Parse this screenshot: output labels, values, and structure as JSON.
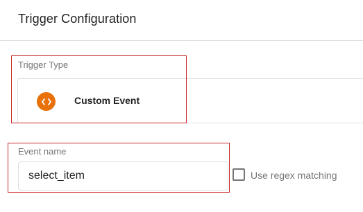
{
  "header": {
    "title": "Trigger Configuration"
  },
  "trigger_type": {
    "label": "Trigger Type",
    "selected": {
      "name": "Custom Event",
      "icon": "code-brackets-icon",
      "icon_color": "#e8710a"
    }
  },
  "event_name": {
    "label": "Event name",
    "value": "select_item"
  },
  "regex": {
    "label": "Use regex matching",
    "checked": false
  },
  "colors": {
    "highlight": "#c62828",
    "border": "#e0e0e0",
    "muted_text": "#757575"
  }
}
